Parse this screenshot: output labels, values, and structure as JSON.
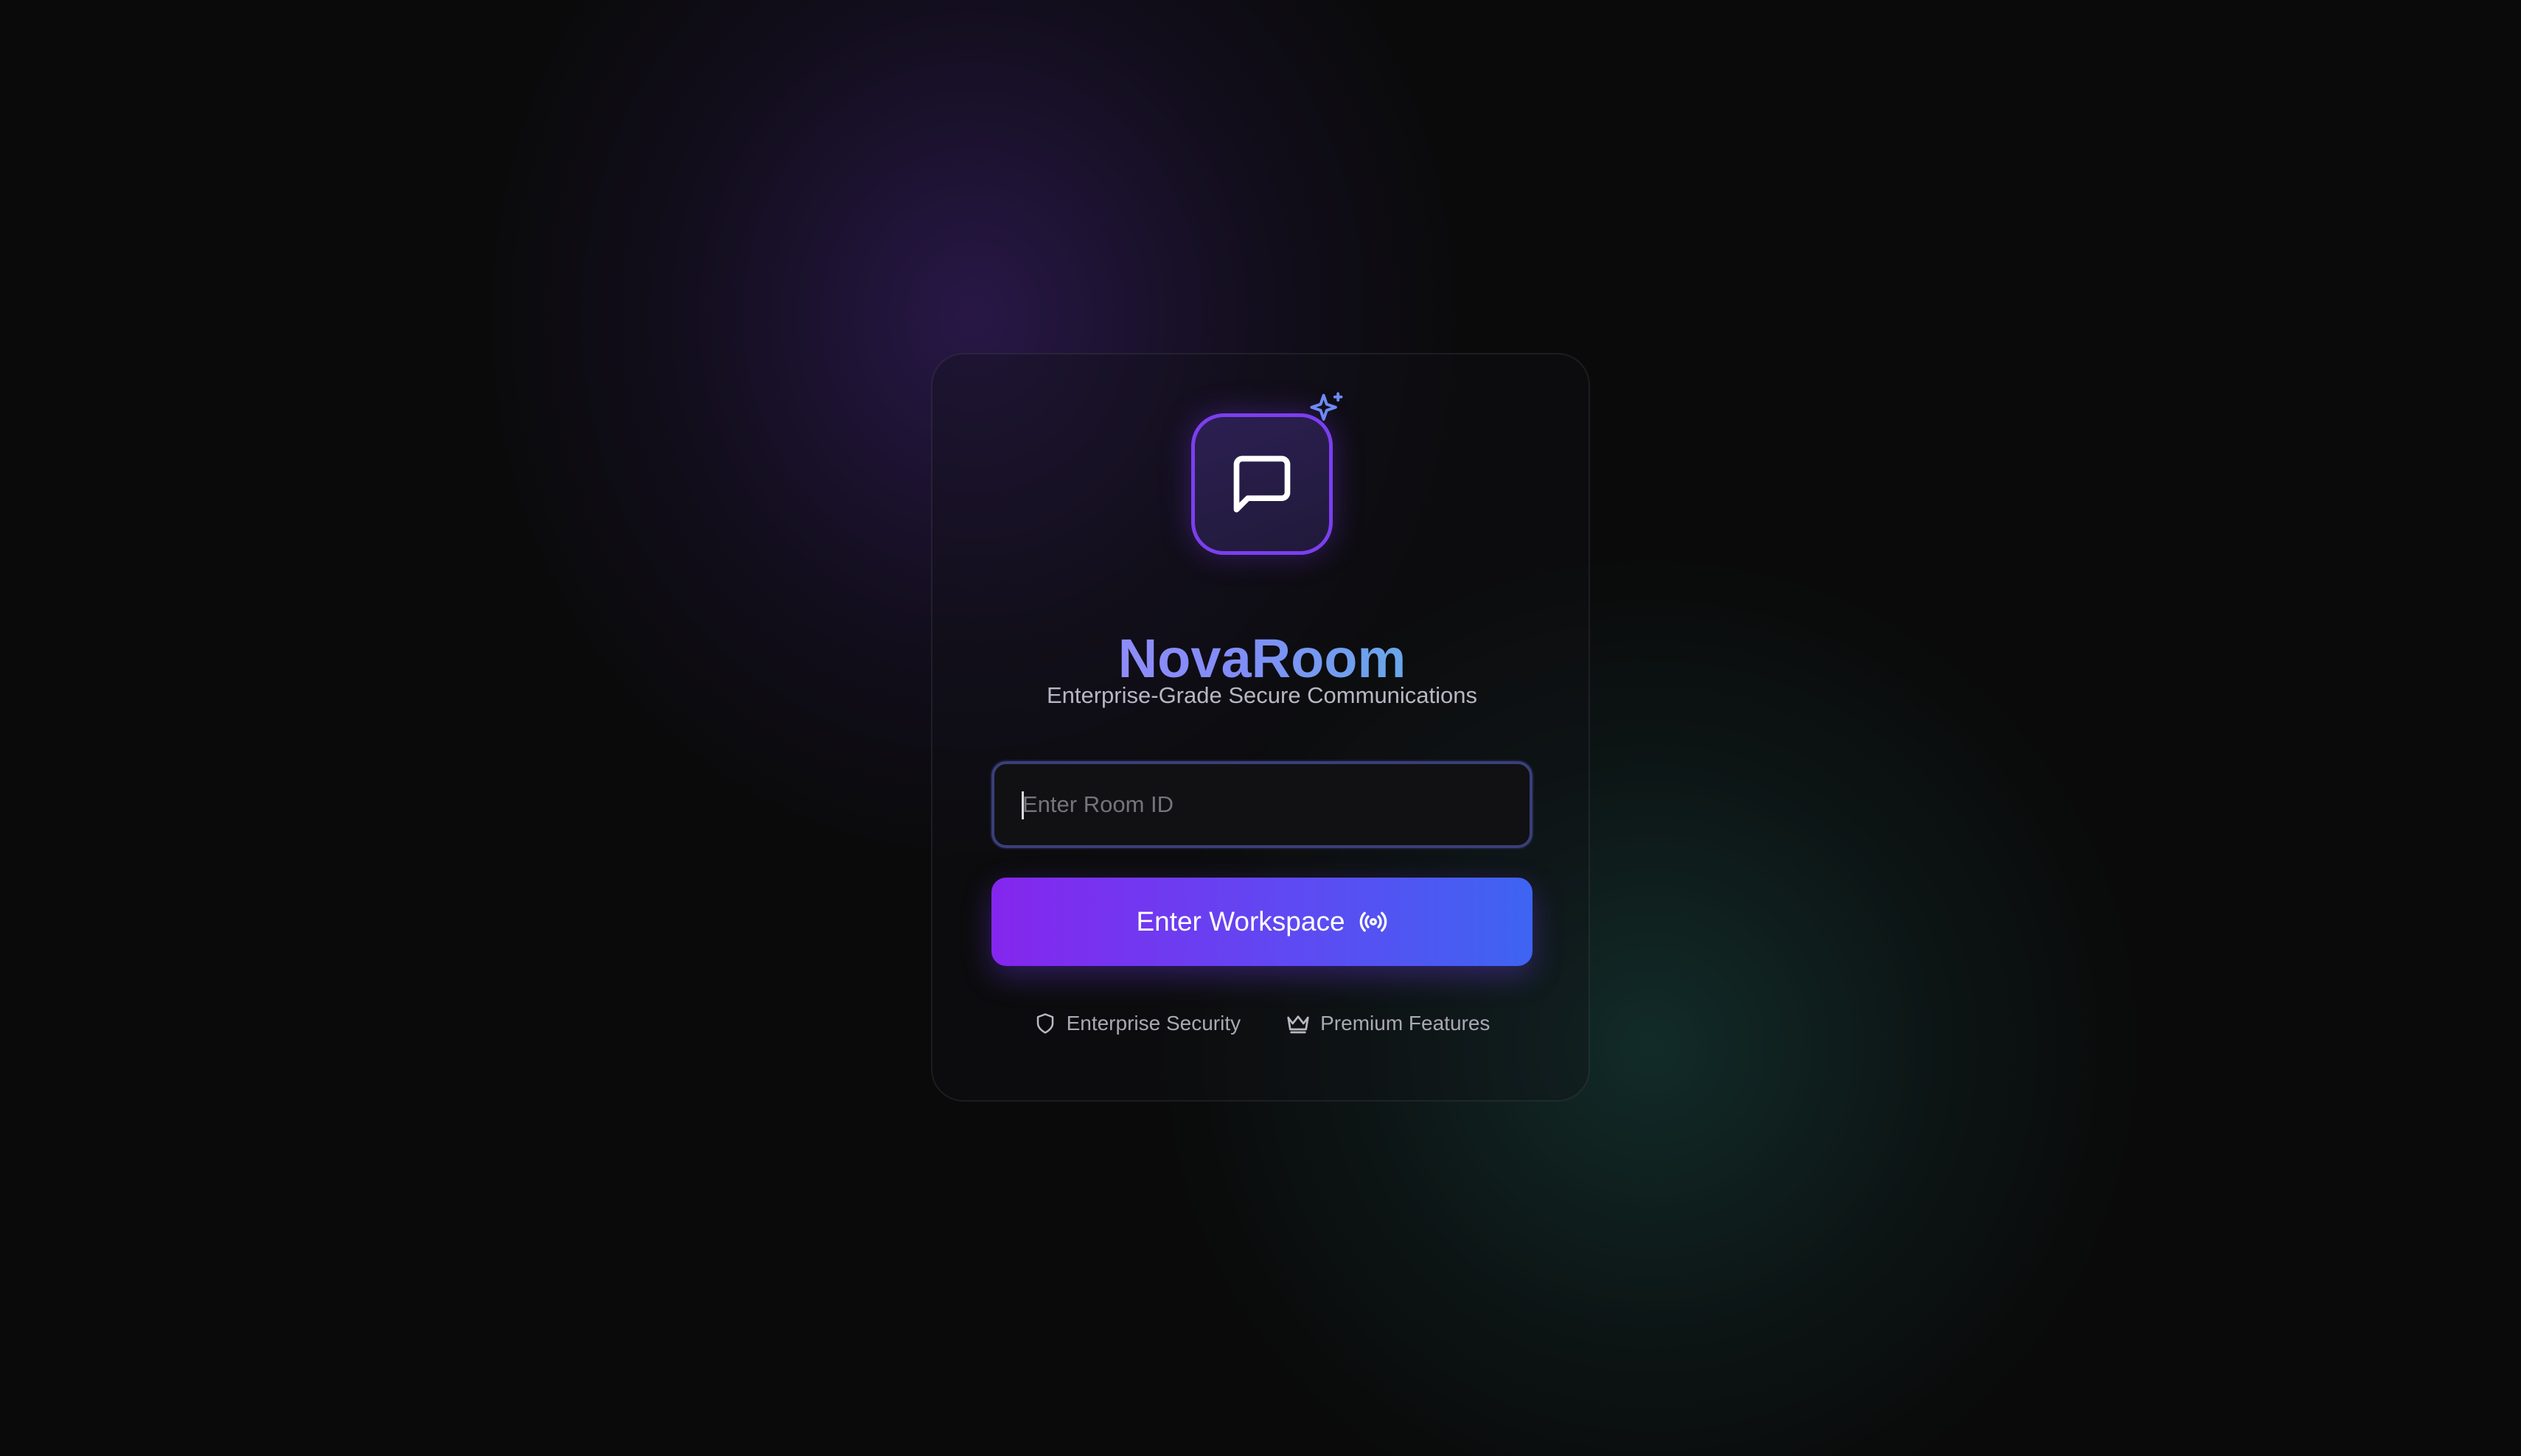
{
  "brand": {
    "name": "NovaRoom",
    "tagline": "Enterprise-Grade Secure Communications",
    "logo_icon": "message-square-icon",
    "sparkle_icon": "sparkles-icon"
  },
  "form": {
    "room_input": {
      "placeholder": "Enter Room ID",
      "value": ""
    },
    "submit_label": "Enter Workspace",
    "submit_icon": "radio-broadcast-icon"
  },
  "features": [
    {
      "icon": "shield-icon",
      "label": "Enterprise Security"
    },
    {
      "icon": "crown-icon",
      "label": "Premium Features"
    }
  ],
  "colors": {
    "background": "#0a0a0a",
    "accent_purple": "#8526ee",
    "accent_blue": "#3e64f2",
    "title_gradient_start": "#a78bfa",
    "title_gradient_end": "#4fc3d9"
  }
}
